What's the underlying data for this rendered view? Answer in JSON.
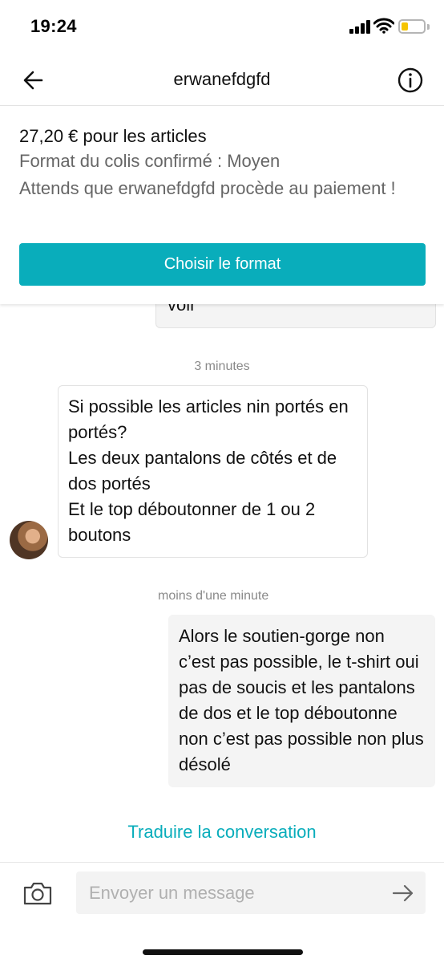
{
  "status_bar": {
    "time": "19:24",
    "icons": [
      "cellular-signal-icon",
      "wifi-icon",
      "battery-icon"
    ],
    "battery_level": 0.3,
    "battery_color": "#f5c400"
  },
  "header": {
    "title": "erwanefdgfd",
    "back_icon": "arrow-left-icon",
    "info_icon": "info-circle-icon"
  },
  "transaction": {
    "price_line": "27,20 € pour les articles",
    "format_line": "Format du colis confirmé : Moyen",
    "waiting_line": "Attends que erwanefdgfd procède au paiement !",
    "button_label": "Choisir le format",
    "accent_color": "#09adbb"
  },
  "conversation": {
    "previous_message_tail": "voir",
    "messages": [
      {
        "timestamp": "3 minutes",
        "direction": "incoming",
        "text": "Si possible les articles nin portés en portés?\nLes deux pantalons de côtés et de dos portés\nEt le top déboutonner de 1 ou 2 boutons"
      },
      {
        "timestamp": "moins d'une minute",
        "direction": "outgoing",
        "text": "Alors le soutien-gorge non c’est pas possible, le t-shirt oui pas de soucis et les pantalons de dos et le top déboutonne non c’est pas possible non plus désolé"
      }
    ],
    "translate_link": "Traduire la conversation"
  },
  "composer": {
    "placeholder": "Envoyer un message",
    "value": "",
    "camera_icon": "camera-icon",
    "send_icon": "arrow-right-icon"
  }
}
